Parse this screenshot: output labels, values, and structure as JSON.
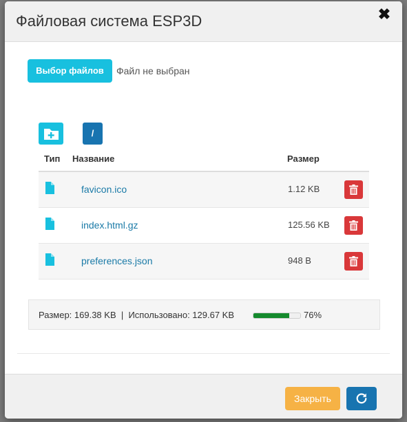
{
  "dialog": {
    "title": "Файловая система ESP3D",
    "close_glyph": "✖"
  },
  "upload": {
    "choose_label": "Выбор файлов",
    "status_text": "Файл не выбран"
  },
  "toolbar": {
    "new_folder_icon": "folder-plus-icon",
    "root_label": "/"
  },
  "table": {
    "columns": [
      "Тип",
      "Название",
      "Размер"
    ],
    "rows": [
      {
        "type_icon": "file-icon",
        "name": "favicon.ico",
        "size": "1.12 KB",
        "action_icon": "trash-icon"
      },
      {
        "type_icon": "file-icon",
        "name": "index.html.gz",
        "size": "125.56 KB",
        "action_icon": "trash-icon"
      },
      {
        "type_icon": "file-icon",
        "name": "preferences.json",
        "size": "948 B",
        "action_icon": "trash-icon"
      }
    ]
  },
  "summary": {
    "text": "Размер: 169.38 KB  |  Использовано: 129.67 KB",
    "percent_label": "76%",
    "used_fraction": 0.76,
    "bar_color": "#158a2d"
  },
  "footer": {
    "close_label": "Закрыть",
    "refresh_icon": "refresh-icon"
  },
  "colors": {
    "accent_cyan": "#18c0df",
    "primary_blue": "#1874b0",
    "danger_red": "#d9383a",
    "warning_orange": "#f6b245",
    "link_blue": "#1a7aa7"
  }
}
